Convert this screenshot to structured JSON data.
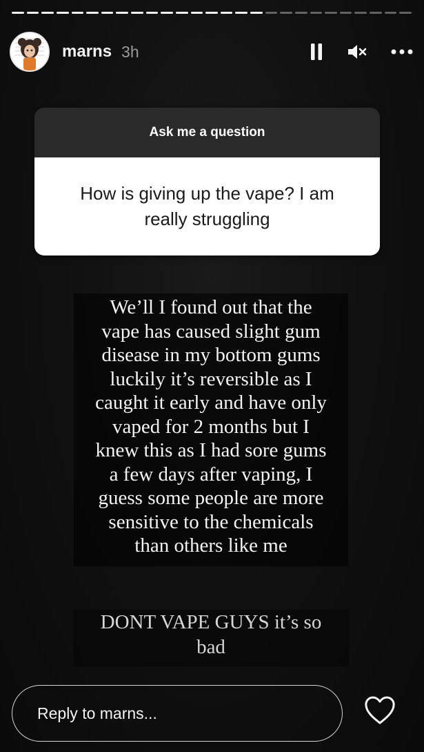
{
  "story": {
    "progress": [
      {
        "fill": 1.0
      },
      {
        "fill": 1.0
      },
      {
        "fill": 1.0
      },
      {
        "fill": 1.0
      },
      {
        "fill": 1.0
      },
      {
        "fill": 1.0
      },
      {
        "fill": 1.0
      },
      {
        "fill": 1.0
      },
      {
        "fill": 1.0
      },
      {
        "fill": 1.0
      },
      {
        "fill": 1.0
      },
      {
        "fill": 1.0
      },
      {
        "fill": 1.0
      },
      {
        "fill": 1.0
      },
      {
        "fill": 1.0
      },
      {
        "fill": 1.0
      },
      {
        "fill": 1.0
      },
      {
        "fill": 0.0
      },
      {
        "fill": 0.0
      },
      {
        "fill": 0.0
      },
      {
        "fill": 0.0
      },
      {
        "fill": 0.0
      },
      {
        "fill": 0.0
      },
      {
        "fill": 0.0
      },
      {
        "fill": 0.0
      },
      {
        "fill": 0.0
      },
      {
        "fill": 0.0
      }
    ]
  },
  "header": {
    "username": "marns",
    "time": "3h",
    "icons": [
      "pause-icon",
      "mute-icon",
      "more-icon"
    ]
  },
  "question_sticker": {
    "title": "Ask me a question",
    "question_lines": [
      "How is giving up the vape? I am",
      "really struggling"
    ]
  },
  "story_text": {
    "lines": [
      "We’ll I found out that the",
      "vape has caused slight gum",
      "disease in my bottom gums",
      "luckily it’s reversible as I",
      "caught it early and have only",
      "vaped for 2 months but I",
      "knew this as I had sore gums",
      "a few days after vaping, I",
      "guess some people are more",
      "sensitive to the chemicals",
      "than others like me"
    ],
    "cta_lines": [
      "DONT VAPE GUYS it’s so",
      "bad"
    ]
  },
  "footer": {
    "reply_placeholder": "Reply to marns...",
    "heart_icon": "heart-icon"
  },
  "colors": {
    "background": "#111111",
    "question_header": "#2a2a2a",
    "question_body": "#ffffff"
  }
}
